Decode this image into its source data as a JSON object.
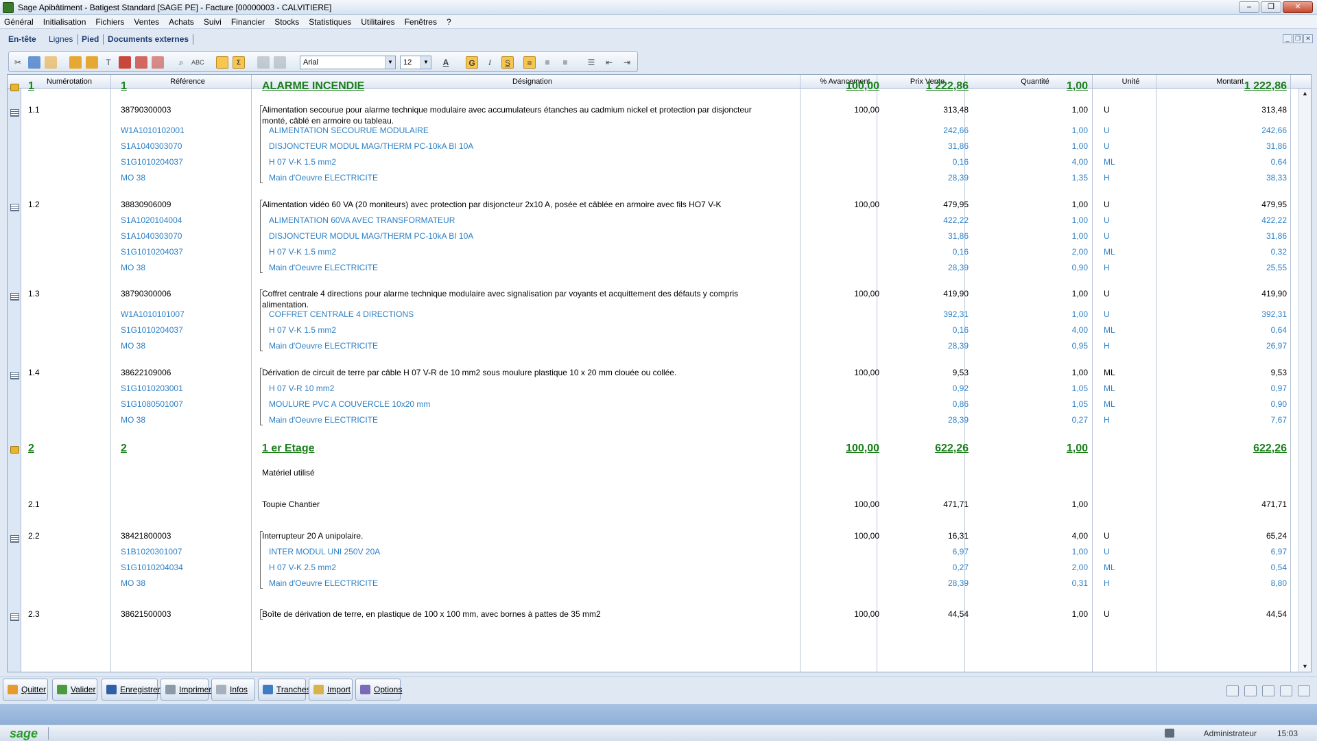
{
  "window": {
    "title": "Sage Apibâtiment - Batigest Standard [SAGE PE] - Facture [00000003 - CALVITIERE]",
    "minimize": "–",
    "restore": "❐",
    "close": "✕"
  },
  "menu": [
    "Général",
    "Initialisation",
    "Fichiers",
    "Ventes",
    "Achats",
    "Suivi",
    "Financier",
    "Stocks",
    "Statistiques",
    "Utilitaires",
    "Fenêtres",
    "?"
  ],
  "tabs": {
    "en_tete": "En-tête",
    "lignes": "Lignes",
    "pied": "Pied",
    "docs": "Documents externes"
  },
  "toolbar": {
    "font": "Arial",
    "size": "12",
    "bold": "G",
    "italic": "I",
    "strike": "S"
  },
  "columns": {
    "num": "Numérotation",
    "ref": "Référence",
    "des": "Désignation",
    "av": "% Avancement",
    "pv": "Prix Vente",
    "qte": "Quantité",
    "unite": "Unité",
    "mt": "Montant"
  },
  "rows": [
    {
      "kind": "t1",
      "icon": "folder",
      "num": "1",
      "ref": "1",
      "des": [
        "ALARME INCENDIE"
      ],
      "av": "100,00",
      "pv": "1 222,86",
      "qte": "1,00",
      "unite": "",
      "mt": "1 222,86"
    },
    {
      "kind": "art",
      "icon": "lines",
      "num": "1.1",
      "ref": "38790300003",
      "des": [
        "Alimentation secourue pour alarme technique modulaire avec accumulateurs étanches au cadmium nickel et protection par disjoncteur",
        "monté, câblé en armoire ou tableau."
      ],
      "av": "100,00",
      "pv": "313,48",
      "qte": "1,00",
      "unite": "U",
      "mt": "313,48"
    },
    {
      "kind": "sub",
      "num": "",
      "ref": "W1A1010102001",
      "des": [
        "ALIMENTATION SECOURUE MODULAIRE"
      ],
      "av": "",
      "pv": "242,66",
      "qte": "1,00",
      "unite": "U",
      "mt": "242,66"
    },
    {
      "kind": "sub",
      "num": "",
      "ref": "S1A1040303070",
      "des": [
        "DISJONCTEUR MODUL MAG/THERM PC-10kA BI 10A"
      ],
      "av": "",
      "pv": "31,86",
      "qte": "1,00",
      "unite": "U",
      "mt": "31,86"
    },
    {
      "kind": "sub",
      "num": "",
      "ref": "S1G1010204037",
      "des": [
        "H 07 V-K 1.5 mm2"
      ],
      "av": "",
      "pv": "0,16",
      "qte": "4,00",
      "unite": "ML",
      "mt": "0,64"
    },
    {
      "kind": "sub",
      "num": "",
      "ref": "MO 38",
      "des": [
        "Main d'Oeuvre ELECTRICITE"
      ],
      "av": "",
      "pv": "28,39",
      "qte": "1,35",
      "unite": "H",
      "mt": "38,33"
    },
    {
      "kind": "art",
      "icon": "lines",
      "num": "1.2",
      "ref": "38830906009",
      "des": [
        "Alimentation vidéo 60 VA (20 moniteurs) avec protection par disjoncteur 2x10 A, posée et câblée en armoire avec fils HO7 V-K"
      ],
      "av": "100,00",
      "pv": "479,95",
      "qte": "1,00",
      "unite": "U",
      "mt": "479,95"
    },
    {
      "kind": "sub",
      "num": "",
      "ref": "S1A1020104004",
      "des": [
        "ALIMENTATION 60VA AVEC TRANSFORMATEUR"
      ],
      "av": "",
      "pv": "422,22",
      "qte": "1,00",
      "unite": "U",
      "mt": "422,22"
    },
    {
      "kind": "sub",
      "num": "",
      "ref": "S1A1040303070",
      "des": [
        "DISJONCTEUR MODUL MAG/THERM PC-10kA BI 10A"
      ],
      "av": "",
      "pv": "31,86",
      "qte": "1,00",
      "unite": "U",
      "mt": "31,86"
    },
    {
      "kind": "sub",
      "num": "",
      "ref": "S1G1010204037",
      "des": [
        "H 07 V-K 1.5 mm2"
      ],
      "av": "",
      "pv": "0,16",
      "qte": "2,00",
      "unite": "ML",
      "mt": "0,32"
    },
    {
      "kind": "sub",
      "num": "",
      "ref": "MO 38",
      "des": [
        "Main d'Oeuvre ELECTRICITE"
      ],
      "av": "",
      "pv": "28,39",
      "qte": "0,90",
      "unite": "H",
      "mt": "25,55"
    },
    {
      "kind": "art",
      "icon": "lines",
      "num": "1.3",
      "ref": "38790300006",
      "des": [
        "Coffret centrale 4 directions pour alarme technique modulaire avec signalisation par voyants et acquittement des défauts y compris",
        "alimentation."
      ],
      "av": "100,00",
      "pv": "419,90",
      "qte": "1,00",
      "unite": "U",
      "mt": "419,90"
    },
    {
      "kind": "sub",
      "num": "",
      "ref": "W1A1010101007",
      "des": [
        "COFFRET CENTRALE 4 DIRECTIONS"
      ],
      "av": "",
      "pv": "392,31",
      "qte": "1,00",
      "unite": "U",
      "mt": "392,31"
    },
    {
      "kind": "sub",
      "num": "",
      "ref": "S1G1010204037",
      "des": [
        "H 07 V-K 1.5 mm2"
      ],
      "av": "",
      "pv": "0,16",
      "qte": "4,00",
      "unite": "ML",
      "mt": "0,64"
    },
    {
      "kind": "sub",
      "num": "",
      "ref": "MO 38",
      "des": [
        "Main d'Oeuvre ELECTRICITE"
      ],
      "av": "",
      "pv": "28,39",
      "qte": "0,95",
      "unite": "H",
      "mt": "26,97"
    },
    {
      "kind": "art",
      "icon": "lines",
      "num": "1.4",
      "ref": "38622109006",
      "des": [
        "Dérivation de circuit de terre par câble H 07 V-R de 10 mm2 sous moulure plastique 10 x 20 mm clouée ou collée."
      ],
      "av": "100,00",
      "pv": "9,53",
      "qte": "1,00",
      "unite": "ML",
      "mt": "9,53"
    },
    {
      "kind": "sub",
      "num": "",
      "ref": "S1G1010203001",
      "des": [
        "H 07 V-R 10 mm2"
      ],
      "av": "",
      "pv": "0,92",
      "qte": "1,05",
      "unite": "ML",
      "mt": "0,97"
    },
    {
      "kind": "sub",
      "num": "",
      "ref": "S1G1080501007",
      "des": [
        "MOULURE PVC A COUVERCLE 10x20 mm"
      ],
      "av": "",
      "pv": "0,86",
      "qte": "1,05",
      "unite": "ML",
      "mt": "0,90"
    },
    {
      "kind": "sub",
      "num": "",
      "ref": "MO 38",
      "des": [
        "Main d'Oeuvre ELECTRICITE"
      ],
      "av": "",
      "pv": "28,39",
      "qte": "0,27",
      "unite": "H",
      "mt": "7,67"
    },
    {
      "kind": "t1",
      "icon": "folder",
      "num": "2",
      "ref": "2",
      "des": [
        "1 er Etage"
      ],
      "av": "100,00",
      "pv": "622,26",
      "qte": "1,00",
      "unite": "",
      "mt": "622,26"
    },
    {
      "kind": "txt",
      "num": "",
      "ref": "",
      "des": [
        "Matériel utilisé"
      ],
      "av": "",
      "pv": "",
      "qte": "",
      "unite": "",
      "mt": ""
    },
    {
      "kind": "art",
      "num": "2.1",
      "ref": "",
      "des": [
        "Toupie Chantier"
      ],
      "av": "100,00",
      "pv": "471,71",
      "qte": "1,00",
      "unite": "",
      "mt": "471,71"
    },
    {
      "kind": "art",
      "icon": "lines",
      "num": "2.2",
      "ref": "38421800003",
      "des": [
        "Interrupteur 20 A unipolaire."
      ],
      "av": "100,00",
      "pv": "16,31",
      "qte": "4,00",
      "unite": "U",
      "mt": "65,24"
    },
    {
      "kind": "sub",
      "num": "",
      "ref": "S1B1020301007",
      "des": [
        "INTER MODUL UNI 250V 20A"
      ],
      "av": "",
      "pv": "6,97",
      "qte": "1,00",
      "unite": "U",
      "mt": "6,97"
    },
    {
      "kind": "sub",
      "num": "",
      "ref": "S1G1010204034",
      "des": [
        "H 07 V-K 2.5 mm2"
      ],
      "av": "",
      "pv": "0,27",
      "qte": "2,00",
      "unite": "ML",
      "mt": "0,54"
    },
    {
      "kind": "sub",
      "num": "",
      "ref": "MO 38",
      "des": [
        "Main d'Oeuvre ELECTRICITE"
      ],
      "av": "",
      "pv": "28,39",
      "qte": "0,31",
      "unite": "H",
      "mt": "8,80"
    },
    {
      "kind": "art",
      "icon": "lines",
      "num": "2.3",
      "ref": "38621500003",
      "des": [
        "Boîte de dérivation de terre, en plastique de 100 x 100 mm, avec bornes à pattes de 35 mm2"
      ],
      "av": "100,00",
      "pv": "44,54",
      "qte": "1,00",
      "unite": "U",
      "mt": "44,54"
    }
  ],
  "buttons": {
    "quitter": "Quitter",
    "valider": "Valider",
    "enregistrer": "Enregistrer",
    "imprimer": "Imprimer",
    "infos": "Infos",
    "tranches": "Tranches",
    "import": "Import",
    "options": "Options"
  },
  "status": {
    "logo": "sage",
    "user": "Administrateur",
    "time": "15:03"
  }
}
